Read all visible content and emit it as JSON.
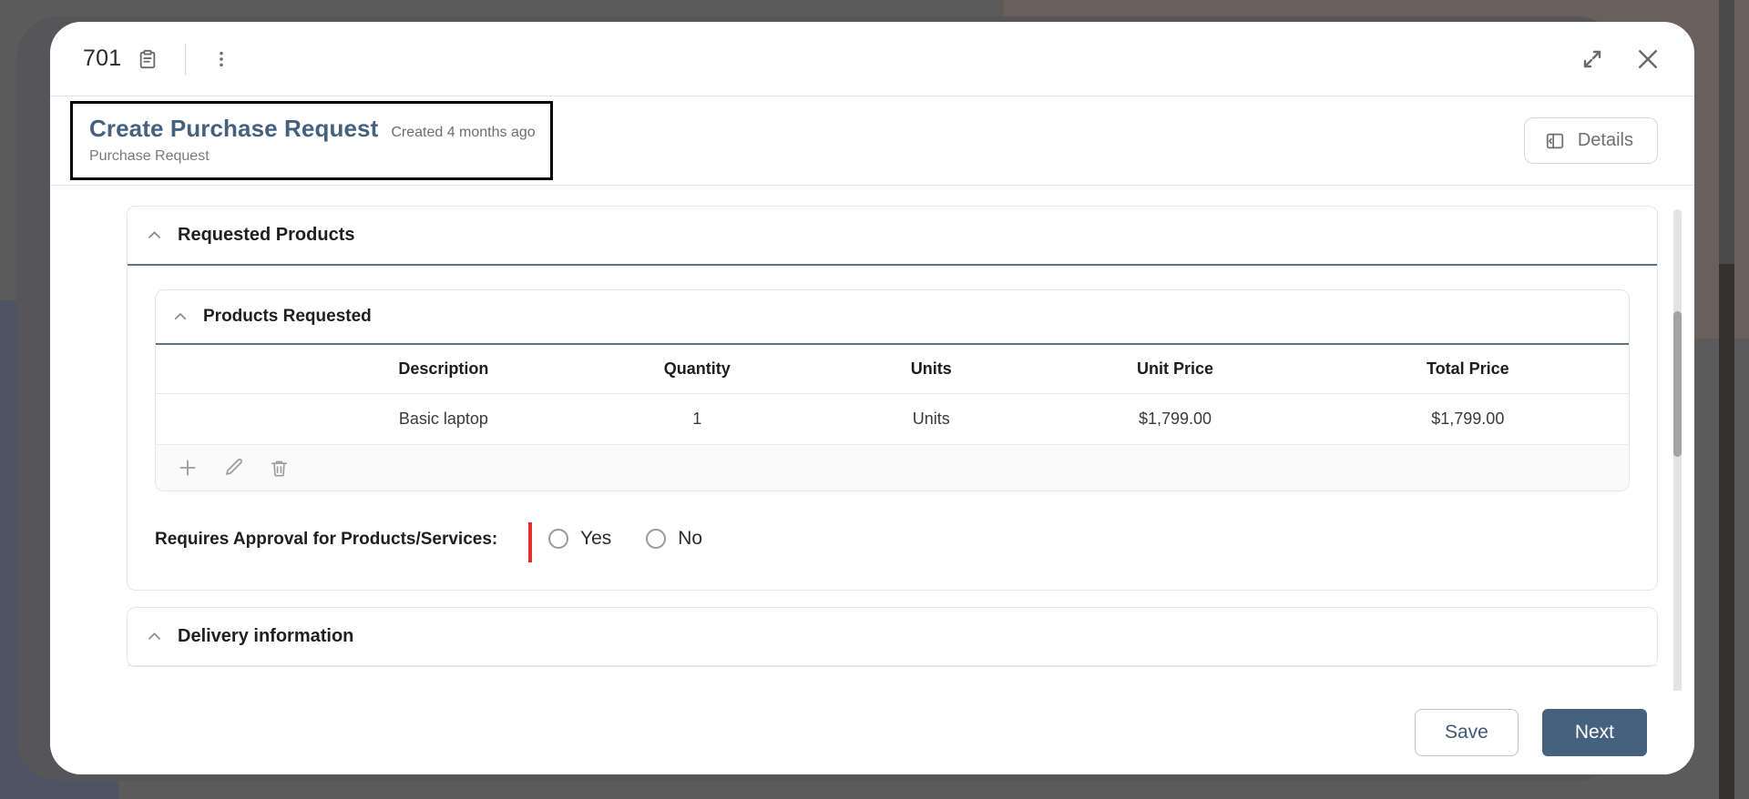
{
  "topbar": {
    "record_id": "701",
    "clipboard_icon": "clipboard-icon",
    "more_icon": "kebab-menu-icon",
    "expand_icon": "expand-icon",
    "close_icon": "close-icon"
  },
  "header": {
    "title": "Create Purchase Request",
    "created": "Created 4 months ago",
    "subtitle": "Purchase Request",
    "details_label": "Details",
    "details_icon": "panel-left-icon"
  },
  "sections": {
    "requested_products": {
      "title": "Requested Products",
      "collapse_icon": "chevron-up-icon"
    },
    "delivery_information": {
      "title": "Delivery information",
      "collapse_icon": "chevron-up-icon"
    }
  },
  "products_requested": {
    "title": "Products Requested",
    "collapse_icon": "chevron-up-icon",
    "columns": [
      "",
      "Description",
      "Quantity",
      "Units",
      "Unit Price",
      "Total Price"
    ],
    "rows": [
      {
        "description": "Basic laptop",
        "quantity": "1",
        "units": "Units",
        "unit_price": "$1,799.00",
        "total_price": "$1,799.00"
      }
    ],
    "toolbar": {
      "add_icon": "plus-icon",
      "edit_icon": "pencil-icon",
      "delete_icon": "trash-icon"
    }
  },
  "approval_field": {
    "label": "Requires Approval for Products/Services:",
    "label_line1": "Requires Approval for Products/Service",
    "label_line2": "s:",
    "required": true,
    "options": [
      {
        "label": "Yes",
        "selected": false
      },
      {
        "label": "No",
        "selected": false
      }
    ]
  },
  "footer": {
    "save_label": "Save",
    "next_label": "Next"
  },
  "colors": {
    "title_blue": "#44627f",
    "primary_button": "#46617f",
    "required_red": "#e03131",
    "section_underline": "#5d718a",
    "backdrop": "#5b5b5c"
  }
}
